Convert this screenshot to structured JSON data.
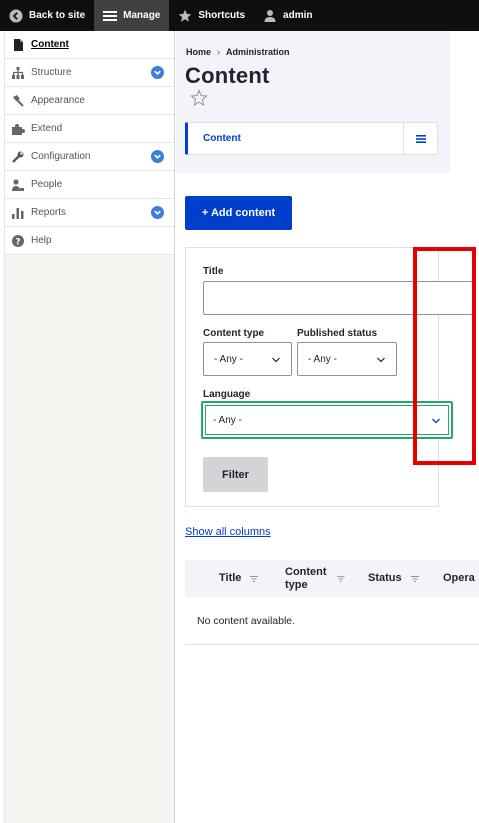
{
  "toolbar": {
    "back_label": "Back to site",
    "manage_label": "Manage",
    "shortcuts_label": "Shortcuts",
    "user_label": "admin"
  },
  "sidebar": {
    "items": [
      {
        "label": "Content",
        "icon": "file-icon",
        "active": true,
        "expandable": false
      },
      {
        "label": "Structure",
        "icon": "sitemap-icon",
        "active": false,
        "expandable": true
      },
      {
        "label": "Appearance",
        "icon": "paintbrush-icon",
        "active": false,
        "expandable": false
      },
      {
        "label": "Extend",
        "icon": "puzzle-icon",
        "active": false,
        "expandable": false
      },
      {
        "label": "Configuration",
        "icon": "wrench-icon",
        "active": false,
        "expandable": true
      },
      {
        "label": "People",
        "icon": "people-icon",
        "active": false,
        "expandable": false
      },
      {
        "label": "Reports",
        "icon": "bar-chart-icon",
        "active": false,
        "expandable": true
      },
      {
        "label": "Help",
        "icon": "help-icon",
        "active": false,
        "expandable": false
      }
    ]
  },
  "header": {
    "breadcrumb": [
      "Home",
      "Administration"
    ],
    "breadcrumb_sep": "›",
    "title": "Content",
    "tab_label": "Content"
  },
  "actions": {
    "add_content": "+ Add content"
  },
  "filter": {
    "title_label": "Title",
    "title_value": "",
    "content_type_label": "Content type",
    "content_type_value": "- Any -",
    "published_label": "Published status",
    "published_value": "- Any -",
    "language_label": "Language",
    "language_value": "- Any -",
    "filter_button": "Filter"
  },
  "table": {
    "show_all_columns": "Show all columns",
    "columns": [
      "Title",
      "Content type",
      "Status",
      "Opera"
    ],
    "empty_message": "No content available."
  },
  "colors": {
    "accent": "#003ecc",
    "toggle_blue": "#3e7ee1",
    "focus_green": "#26a769",
    "highlight_red": "#e60000"
  }
}
